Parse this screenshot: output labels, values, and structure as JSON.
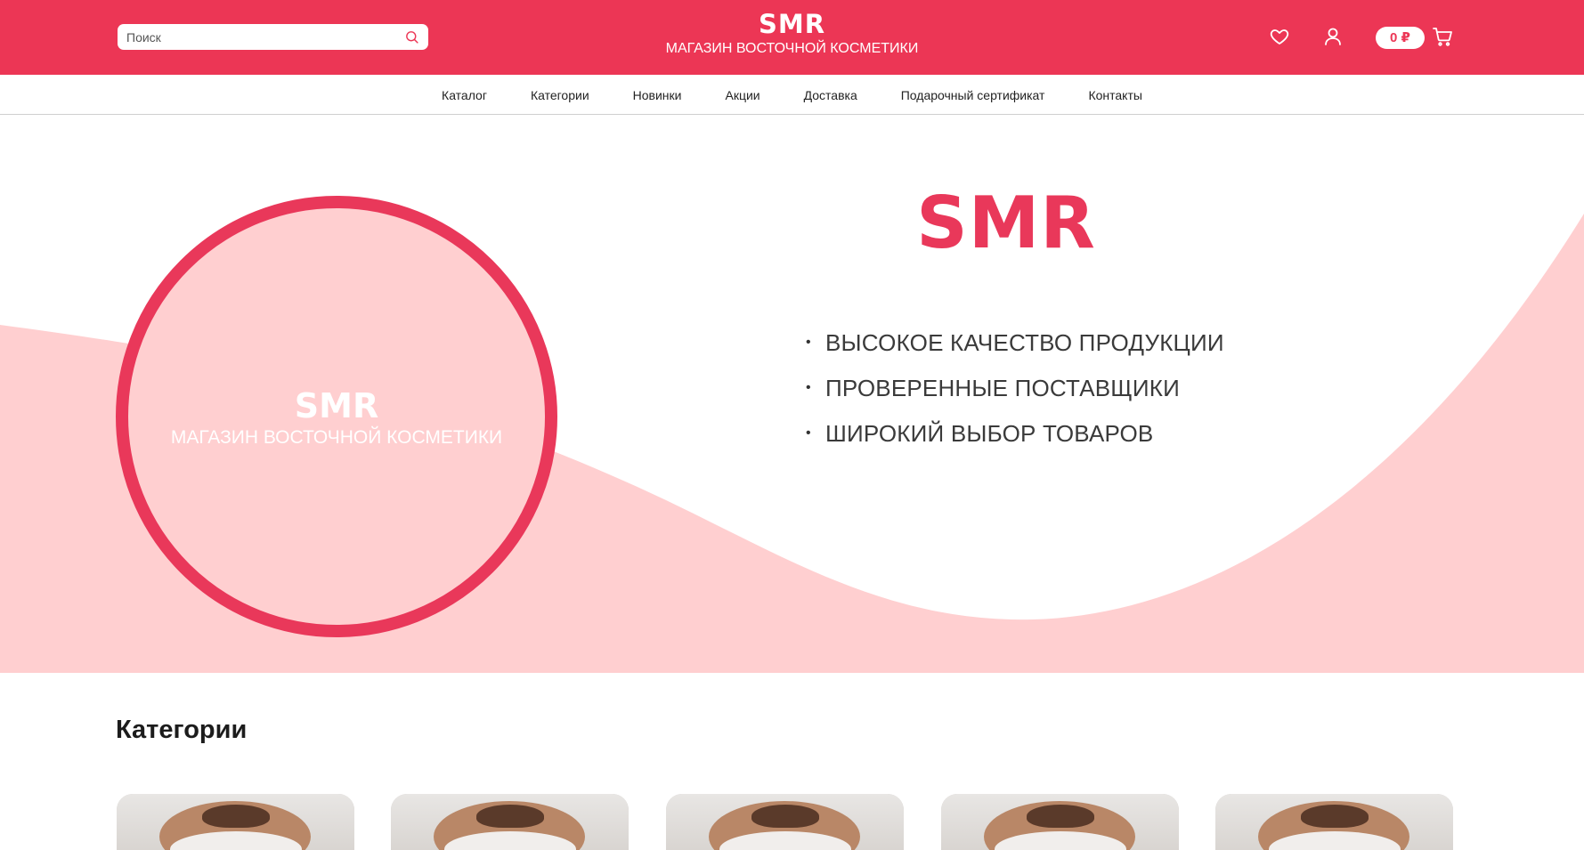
{
  "header": {
    "search_placeholder": "Поиск",
    "brand": "SMR",
    "tagline": "МАГАЗИН ВОСТОЧНОЙ КОСМЕТИКИ",
    "cart_total": "0 ₽",
    "icons": [
      "search-icon",
      "heart-icon",
      "user-icon",
      "cart-icon"
    ]
  },
  "nav": {
    "items": [
      "Каталог",
      "Категории",
      "Новинки",
      "Акции",
      "Доставка",
      "Подарочный сертификат",
      "Контакты"
    ]
  },
  "hero": {
    "circle_brand": "SMR",
    "circle_tagline": "МАГАЗИН ВОСТОЧНОЙ КОСМЕТИКИ",
    "title": "SMR",
    "features": [
      "ВЫСОКОЕ КАЧЕСТВО ПРОДУКЦИИ",
      "ПРОВЕРЕННЫЕ ПОСТАВЩИКИ",
      "ШИРОКИЙ ВЫБОР ТОВАРОВ"
    ]
  },
  "categories": {
    "title": "Категории",
    "card_count": 5
  },
  "colors": {
    "accent": "#ec3655",
    "hero_bg": "#ffcfd0",
    "ring": "#e9385a"
  }
}
